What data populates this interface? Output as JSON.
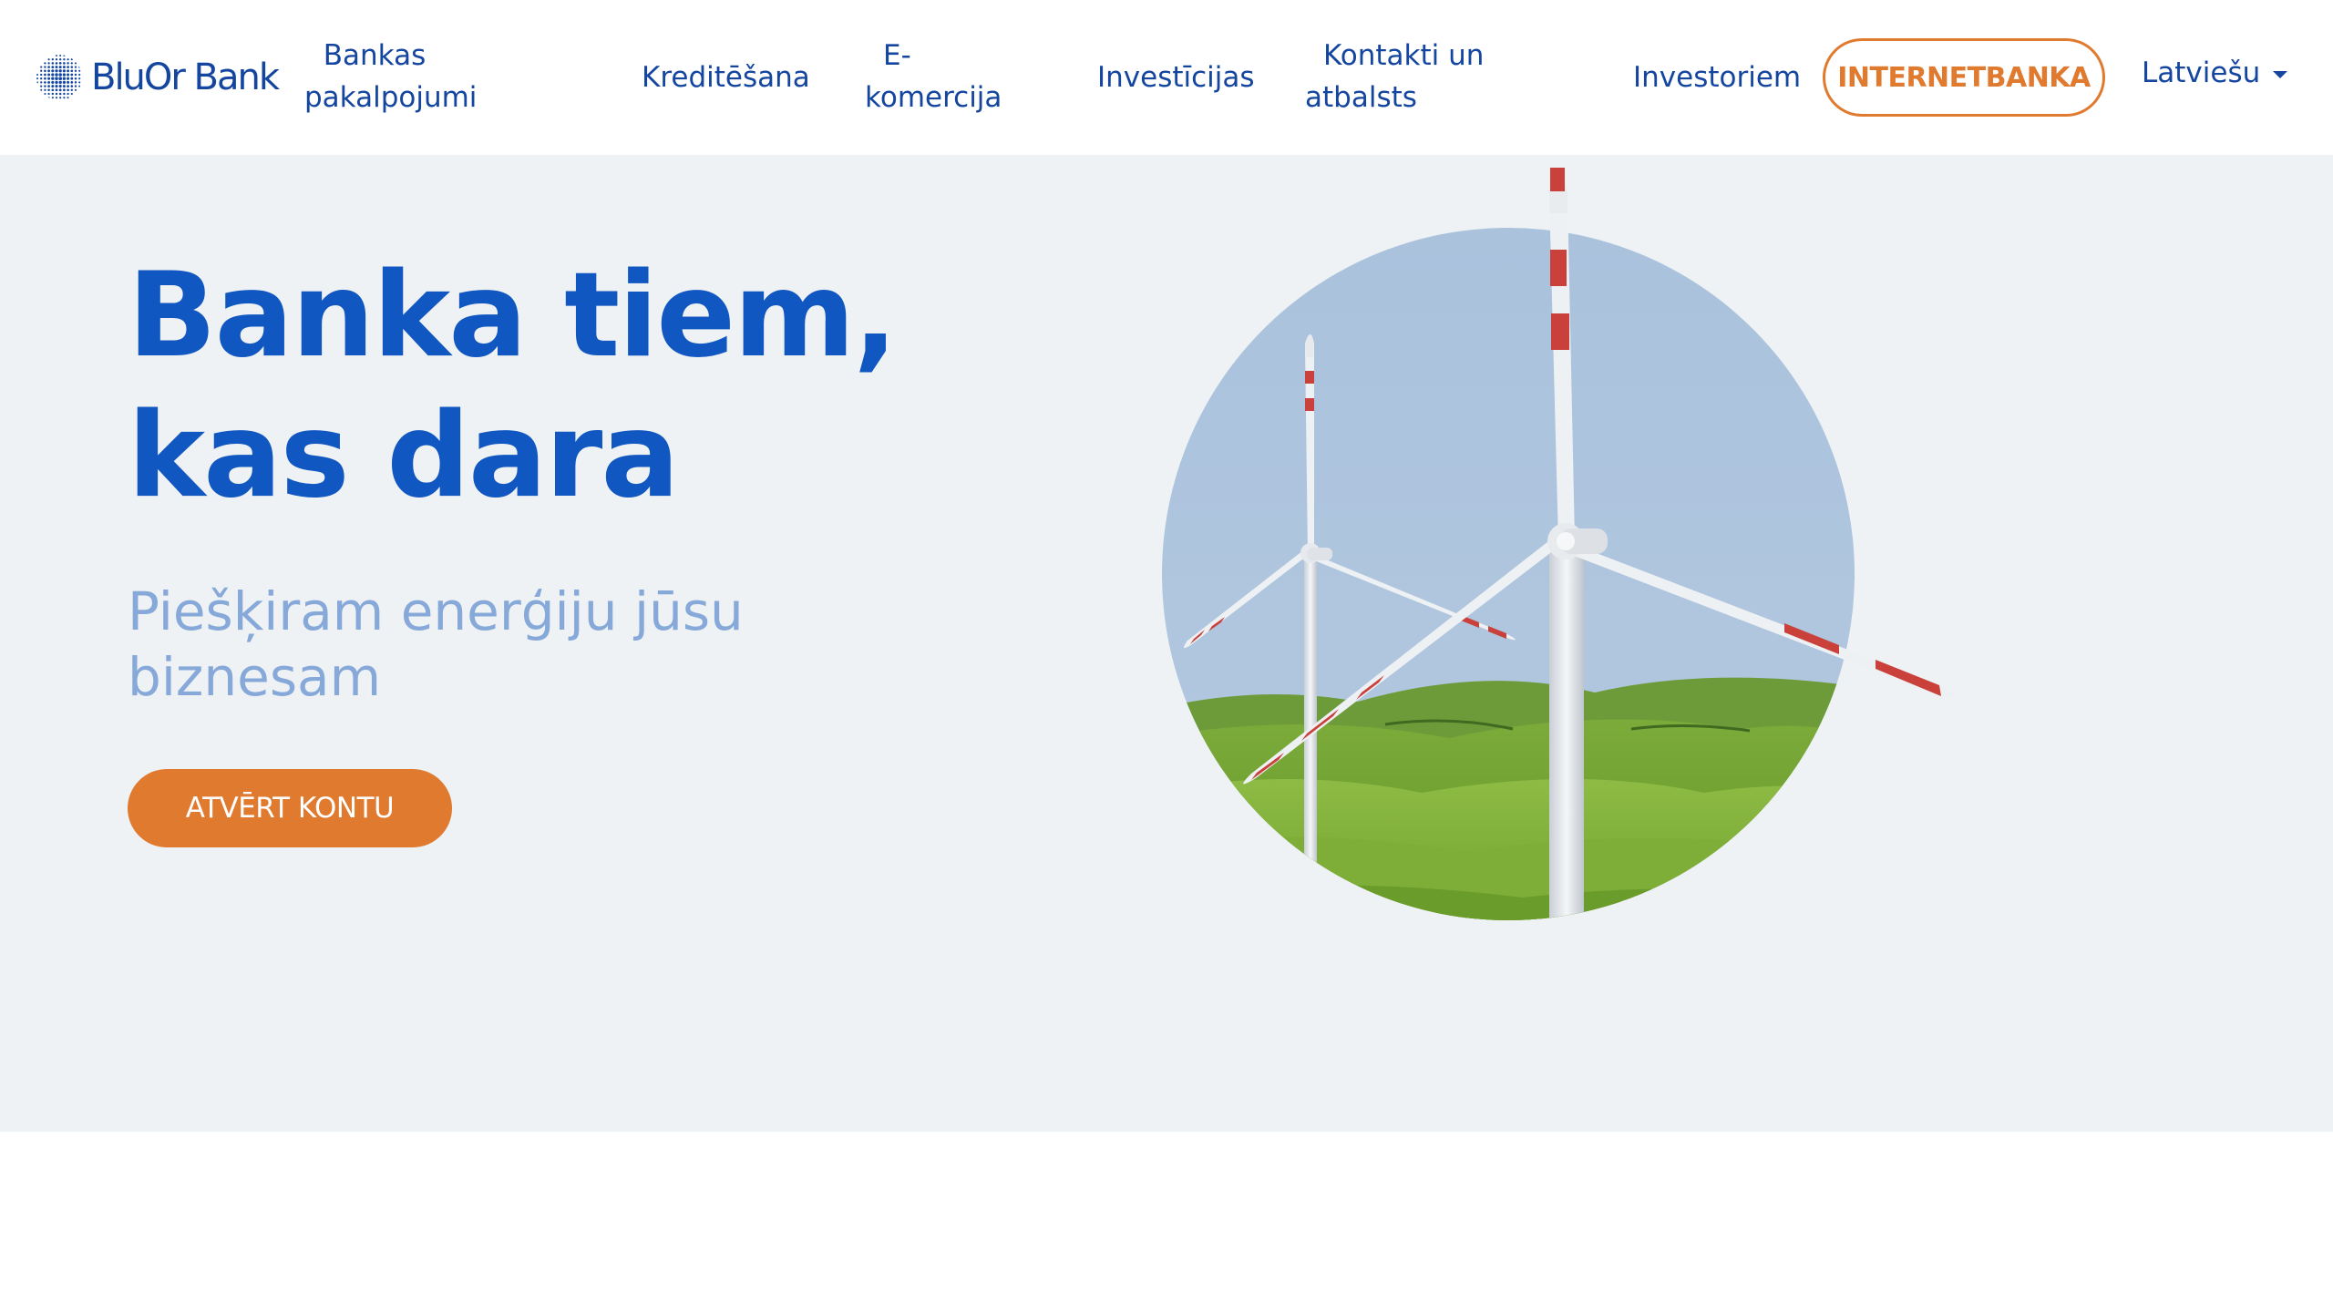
{
  "brand": {
    "logo_text": "BluOr Bank"
  },
  "nav": {
    "items": [
      {
        "label_line1": "Bankas",
        "label_line2": "pakalpojumi"
      },
      {
        "label": "Kreditēšana"
      },
      {
        "label_line1": "E-",
        "label_line2": "komercija"
      },
      {
        "label": "Investīcijas"
      },
      {
        "label_line1": "Kontakti un",
        "label_line2": "atbalsts"
      },
      {
        "label": "Investoriem"
      }
    ],
    "internetbanka_label": "INTERNETBANKA",
    "language_label": "Latviešu"
  },
  "hero": {
    "title_line1": "Banka tiem,",
    "title_line2": "kas dara",
    "subtitle_line1": "Piešķiram enerģiju jūsu",
    "subtitle_line2": "biznesam",
    "cta_label": "ATVĒRT KONTU",
    "image_icon": "wind-turbines-image"
  },
  "colors": {
    "brand_blue": "#1157c1",
    "nav_blue": "#1446a0",
    "accent_orange": "#e07a2f",
    "hero_bg": "#eff2f4",
    "subtitle_blue": "#86a9d9"
  }
}
